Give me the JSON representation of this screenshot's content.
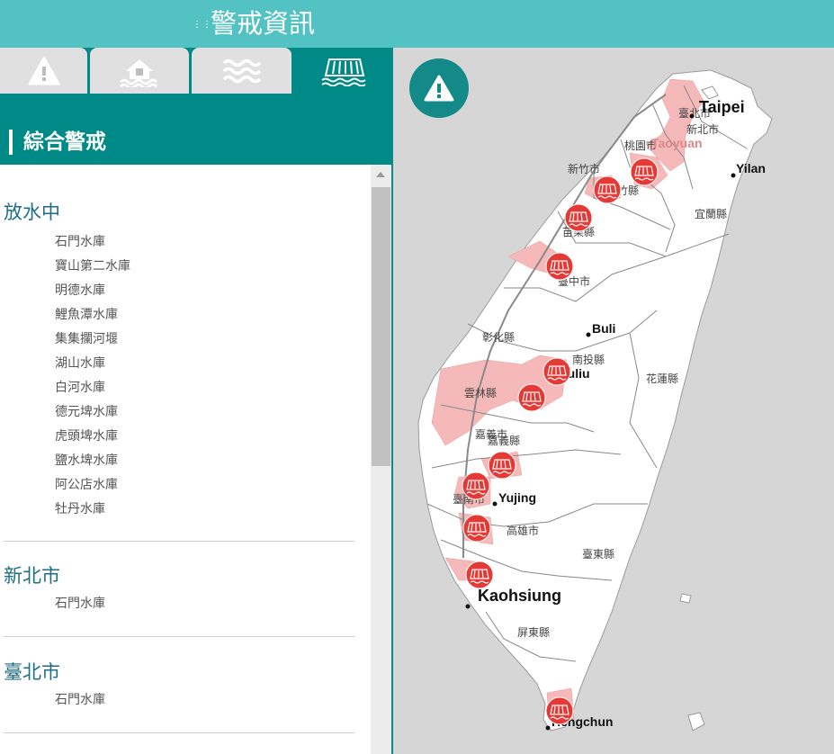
{
  "header": {
    "menu_icon": "menu-dots-icon",
    "title": "警戒資訊"
  },
  "tabs": [
    {
      "icon": "warning-icon",
      "active": false
    },
    {
      "icon": "flood-house-icon",
      "active": false
    },
    {
      "icon": "water-waves-icon",
      "active": false
    },
    {
      "icon": "dam-release-icon",
      "active": true
    }
  ],
  "section": {
    "title": "綜合警戒"
  },
  "groups": [
    {
      "title": "放水中",
      "items": [
        "石門水庫",
        "寶山第二水庫",
        "明德水庫",
        "鯉魚潭水庫",
        "集集攔河堰",
        "湖山水庫",
        "白河水庫",
        "德元埤水庫",
        "虎頭埤水庫",
        "鹽水埤水庫",
        "阿公店水庫",
        "牡丹水庫"
      ]
    },
    {
      "title": "新北市",
      "items": [
        "石門水庫"
      ]
    },
    {
      "title": "臺北市",
      "items": [
        "石門水庫"
      ]
    }
  ],
  "map": {
    "alert_button_icon": "warning-icon",
    "county_labels": [
      "臺北市",
      "新北市",
      "桃園市",
      "新竹市",
      "新竹縣",
      "苗栗縣",
      "臺中市",
      "彰化縣",
      "南投縣",
      "雲林縣",
      "嘉義縣",
      "嘉義市",
      "臺南市",
      "高雄市",
      "屏東縣",
      "臺東縣",
      "花蓮縣",
      "宜蘭縣"
    ],
    "city_labels": [
      "Taipei",
      "Taoyuan",
      "Yilan",
      "Buli",
      "Douliu",
      "Yujing",
      "Kaohsiung",
      "Hengchun"
    ],
    "marker_icon": "dam-release-icon",
    "colors": {
      "marker": "#e53935",
      "alert_area": "#f6b9b9",
      "land": "#ffffff",
      "sea": "#d6d6d6",
      "header": "#53c2c2",
      "panel": "#008a87"
    }
  }
}
